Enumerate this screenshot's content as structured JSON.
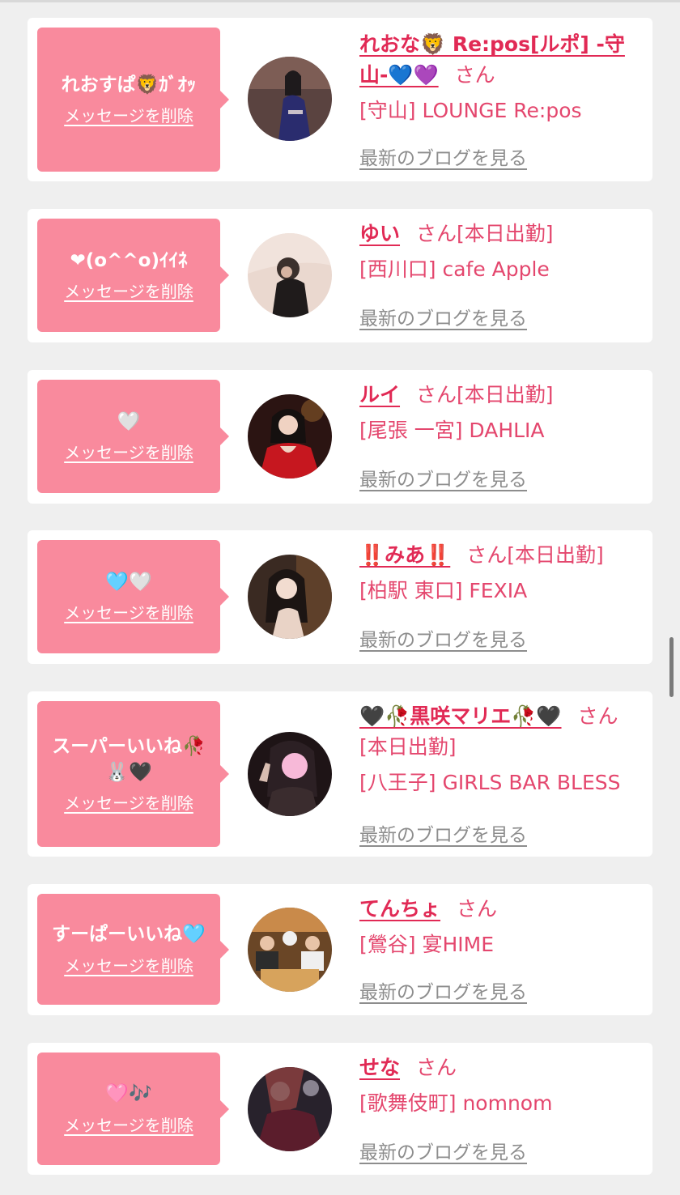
{
  "labels": {
    "delete": "メッセージを削除",
    "blog": "最新のブログを見る",
    "san": "さん"
  },
  "colors": {
    "background": "#efefef",
    "card": "#ffffff",
    "bubble": "#f98a9d",
    "name": "#e12a55",
    "text": "#e4476e",
    "link_gray": "#8d8d8d"
  },
  "items": [
    {
      "message": "れおすぱ🦁ｶﾞｵｯ",
      "name": "れおな🦁 Re:pos[ルポ] -守山-💙💜",
      "status": "",
      "shop": "[守山] LOUNGE Re:pos",
      "avatar_icon": "woman-navy-dress-photo"
    },
    {
      "message": "❤(o^^o)ｲｲﾈ",
      "name": "ゆい",
      "status": "[本日出勤]",
      "shop": "[西川口] cafe Apple",
      "avatar_icon": "woman-black-dress-photo"
    },
    {
      "message": "🤍",
      "name": "ルイ",
      "status": "[本日出勤]",
      "shop": "[尾張 一宮] DAHLIA",
      "avatar_icon": "woman-red-dress-photo"
    },
    {
      "message": "🩵🤍",
      "name": "‼️みあ‼️",
      "status": "[本日出勤]",
      "shop": "[柏駅 東口] FEXIA",
      "avatar_icon": "woman-dark-hair-photo"
    },
    {
      "message": "スーパーいいね🥀🐰🖤",
      "name": "🖤🥀黒咲マリエ🥀🖤",
      "status": "[本日出勤]",
      "shop": "[八王子] GIRLS BAR BLESS",
      "avatar_icon": "woman-peace-sign-photo"
    },
    {
      "message": "すーぱーいいね🩵",
      "name": "てんちょ",
      "status": "",
      "shop": "[鶯谷] 宴HIME",
      "avatar_icon": "group-restaurant-photo"
    },
    {
      "message": "🩷🎶",
      "name": "せな",
      "status": "",
      "shop": "[歌舞伎町] nomnom",
      "avatar_icon": "woman-red-hair-photo"
    }
  ]
}
